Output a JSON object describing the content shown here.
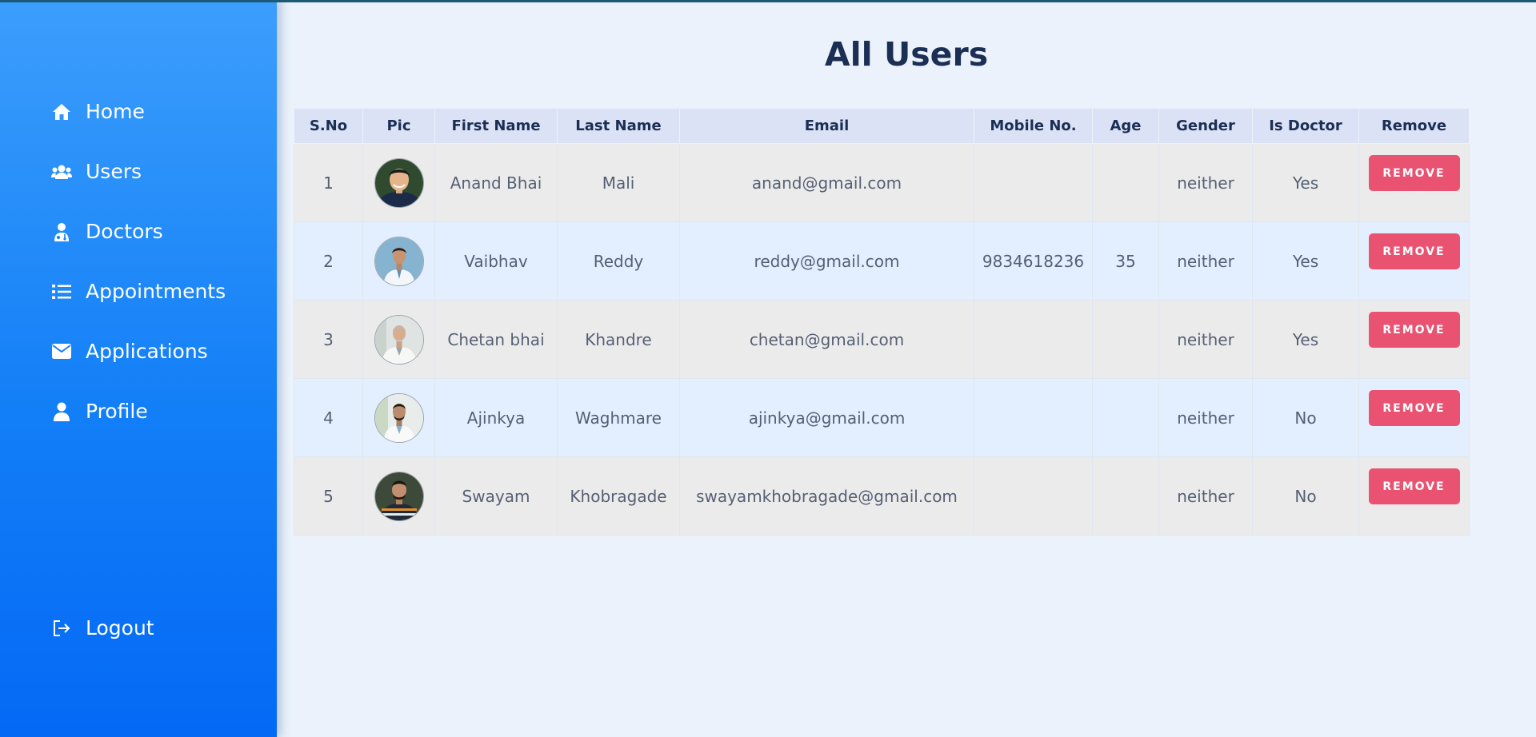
{
  "nav": {
    "items": [
      {
        "label": "Home",
        "icon": "home-icon"
      },
      {
        "label": "Users",
        "icon": "users-icon"
      },
      {
        "label": "Doctors",
        "icon": "doctor-icon"
      },
      {
        "label": "Appointments",
        "icon": "list-icon"
      },
      {
        "label": "Applications",
        "icon": "envelope-icon"
      },
      {
        "label": "Profile",
        "icon": "user-icon"
      }
    ],
    "logout": {
      "label": "Logout",
      "icon": "logout-icon"
    }
  },
  "page": {
    "title": "All Users"
  },
  "table": {
    "headers": [
      "S.No",
      "Pic",
      "First Name",
      "Last Name",
      "Email",
      "Mobile No.",
      "Age",
      "Gender",
      "Is Doctor",
      "Remove"
    ],
    "remove_label": "REMOVE",
    "rows": [
      {
        "sno": "1",
        "first": "Anand Bhai",
        "last": "Mali",
        "email": "anand@gmail.com",
        "mobile": "",
        "age": "",
        "gender": "neither",
        "is_doctor": "Yes",
        "avatar": "avatar-1"
      },
      {
        "sno": "2",
        "first": "Vaibhav",
        "last": "Reddy",
        "email": "reddy@gmail.com",
        "mobile": "9834618236",
        "age": "35",
        "gender": "neither",
        "is_doctor": "Yes",
        "avatar": "avatar-2"
      },
      {
        "sno": "3",
        "first": "Chetan bhai",
        "last": "Khandre",
        "email": "chetan@gmail.com",
        "mobile": "",
        "age": "",
        "gender": "neither",
        "is_doctor": "Yes",
        "avatar": "avatar-3"
      },
      {
        "sno": "4",
        "first": "Ajinkya",
        "last": "Waghmare",
        "email": "ajinkya@gmail.com",
        "mobile": "",
        "age": "",
        "gender": "neither",
        "is_doctor": "No",
        "avatar": "avatar-4"
      },
      {
        "sno": "5",
        "first": "Swayam",
        "last": "Khobragade",
        "email": "swayamkhobragade@gmail.com",
        "mobile": "",
        "age": "",
        "gender": "neither",
        "is_doctor": "No",
        "avatar": "avatar-5"
      }
    ]
  },
  "colors": {
    "sidebar_top": "#3c9efc",
    "sidebar_bottom": "#0469f5",
    "page_background": "#ebf2fb",
    "header_background": "#dce2f5",
    "row_odd": "#ebebeb",
    "row_even": "#e3eefe",
    "remove_button": "#ea5272",
    "title_text": "#1b2f55"
  }
}
